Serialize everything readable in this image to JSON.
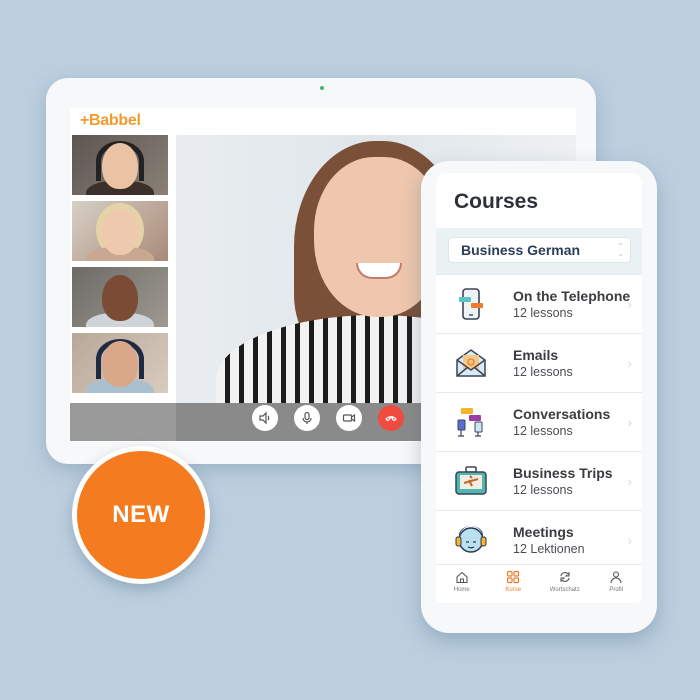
{
  "tablet": {
    "brand": "+Babbel",
    "participants": [
      {
        "name": "participant-1"
      },
      {
        "name": "participant-2"
      },
      {
        "name": "participant-3"
      },
      {
        "name": "participant-4"
      }
    ],
    "controls": [
      {
        "icon": "speaker-icon",
        "glyph": "🔈"
      },
      {
        "icon": "microphone-icon",
        "glyph": "🎙"
      },
      {
        "icon": "video-camera-icon",
        "glyph": "▭"
      },
      {
        "icon": "hang-up-icon",
        "glyph": "☎"
      }
    ]
  },
  "badge": {
    "label": "NEW",
    "color": "#f47b20"
  },
  "phone": {
    "title": "Courses",
    "selector": {
      "value": "Business German"
    },
    "courses": [
      {
        "title": "On the Telephone",
        "subtitle": "12 lessons",
        "icon": "telephone-icon"
      },
      {
        "title": "Emails",
        "subtitle": "12 lessons",
        "icon": "envelope-icon"
      },
      {
        "title": "Conversations",
        "subtitle": "12 lessons",
        "icon": "chat-chairs-icon"
      },
      {
        "title": "Business Trips",
        "subtitle": "12 lessons",
        "icon": "suitcase-icon"
      },
      {
        "title": "Meetings",
        "subtitle": "12 Lektionen",
        "icon": "headset-person-icon"
      }
    ],
    "tabs": [
      {
        "label": "Home",
        "icon": "home-icon",
        "active": false
      },
      {
        "label": "Kurse",
        "icon": "grid-icon",
        "active": true
      },
      {
        "label": "Wortschatz",
        "icon": "refresh-icon",
        "active": false
      },
      {
        "label": "Profil",
        "icon": "profile-icon",
        "active": false
      }
    ]
  },
  "colors": {
    "accent": "#f47b20",
    "brand": "#f29a2e",
    "background": "#bccfdf",
    "end_call": "#ef4b3f"
  }
}
